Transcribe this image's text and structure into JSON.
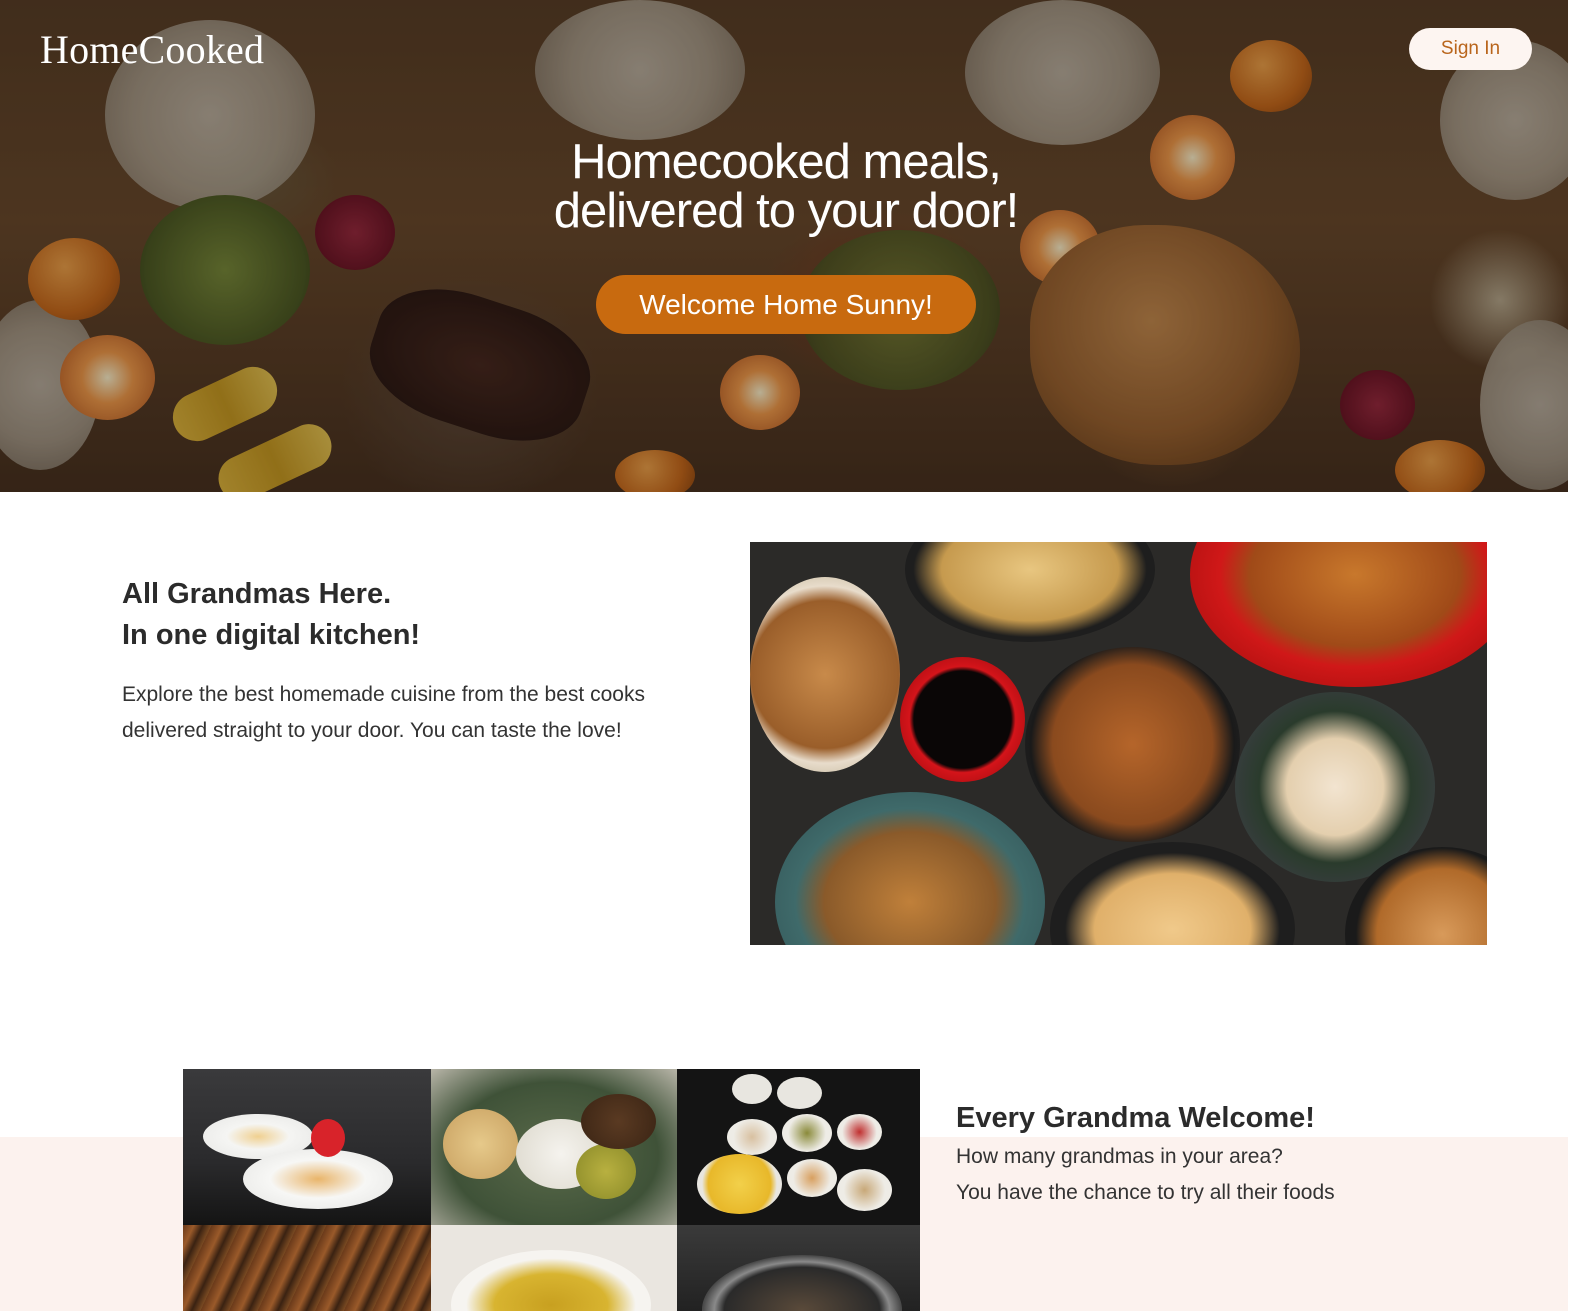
{
  "header": {
    "brand": "HomeCooked",
    "sign_in_label": "Sign In"
  },
  "hero": {
    "title_line1": "Homecooked meals,",
    "title_line2": "delivered to your door!",
    "cta_label": "Welcome Home Sunny!"
  },
  "feature": {
    "heading_line1": "All Grandmas Here.",
    "heading_line2": "In one digital kitchen!",
    "body_line1": "Explore the best homemade cuisine from the best cooks",
    "body_line2": "delivered straight to your door. You can taste the love!"
  },
  "welcome": {
    "heading": "Every Grandma Welcome!",
    "line1": "How many grandmas in your area?",
    "line2": "You have the chance to try all their foods"
  },
  "colors": {
    "accent": "#c86a0f",
    "signin_text": "#b9651c",
    "band_background": "#fcf2ee",
    "text_dark": "#2b2b2b"
  }
}
